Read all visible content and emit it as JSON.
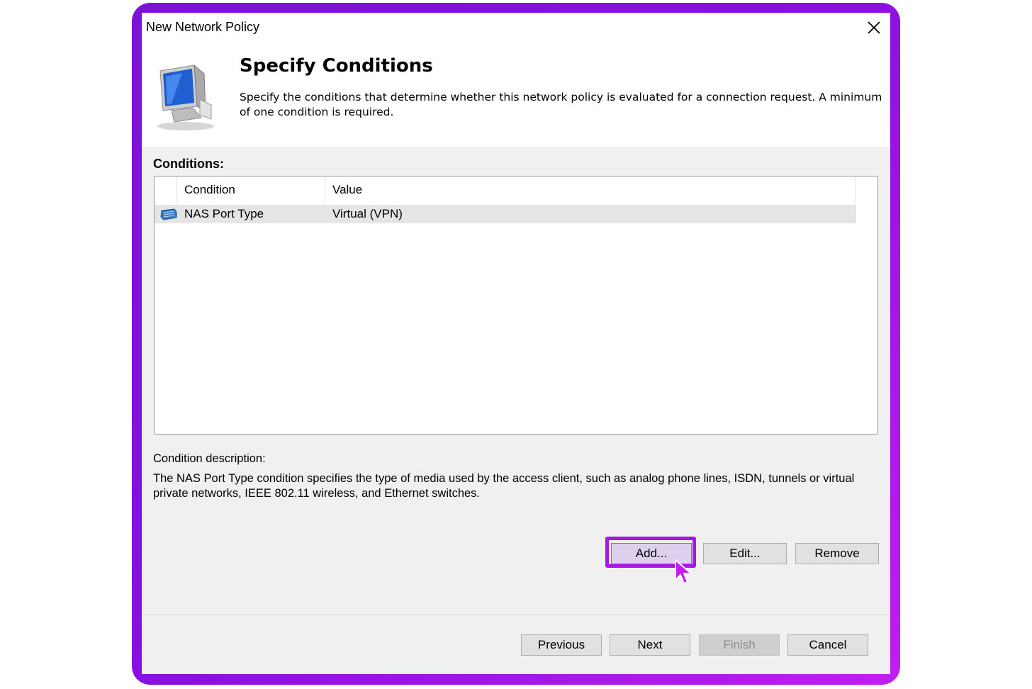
{
  "window": {
    "title": "New Network Policy"
  },
  "header": {
    "title": "Specify Conditions",
    "description": "Specify the conditions that determine whether this network policy is evaluated for a connection request. A minimum of one condition is required."
  },
  "conditions": {
    "label": "Conditions:",
    "columns": [
      "Condition",
      "Value"
    ],
    "rows": [
      {
        "condition": "NAS Port Type",
        "value": "Virtual (VPN)",
        "icon": "network-port-icon"
      }
    ]
  },
  "description": {
    "label": "Condition description:",
    "text": "The NAS Port Type condition specifies the type of media used by the access client, such as analog phone lines, ISDN, tunnels or virtual private networks, IEEE 802.11 wireless, and Ethernet switches."
  },
  "buttons": {
    "add": "Add...",
    "edit": "Edit...",
    "remove": "Remove",
    "previous": "Previous",
    "next": "Next",
    "finish": "Finish",
    "cancel": "Cancel"
  },
  "colors": {
    "frame_gradient_start": "#7a12d6",
    "frame_gradient_end": "#c01ef0",
    "highlight": "#a716e6"
  }
}
